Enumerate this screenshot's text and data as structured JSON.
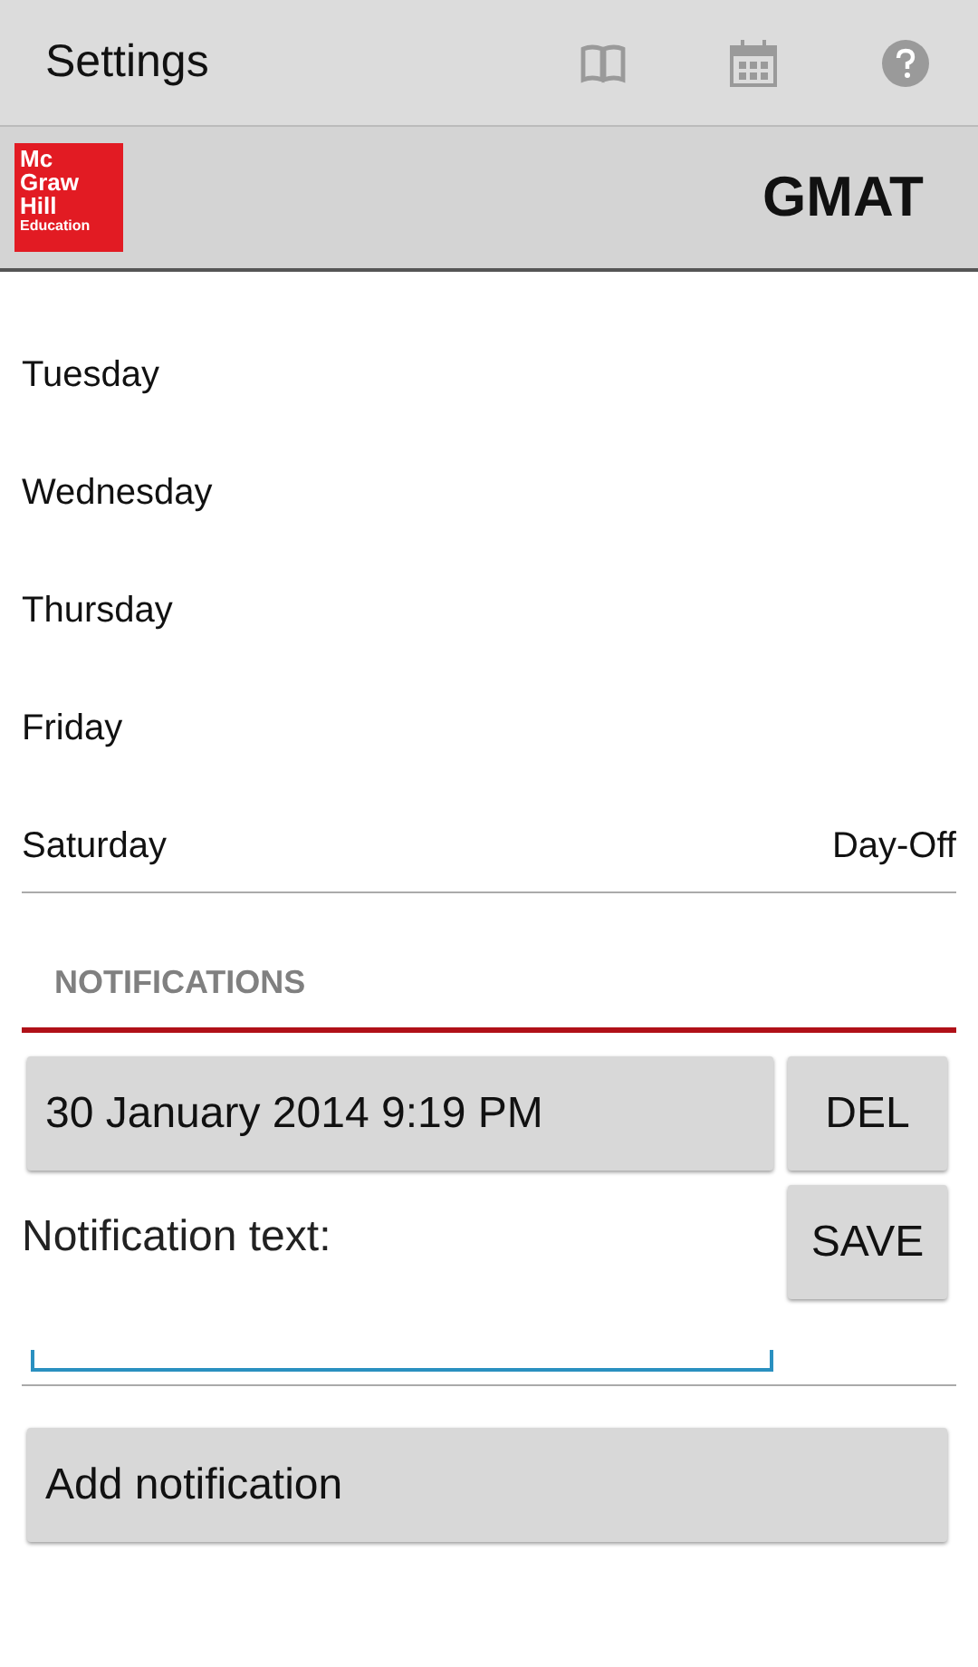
{
  "action_bar": {
    "title": "Settings",
    "actions": [
      {
        "kind": "book"
      },
      {
        "kind": "calendar"
      },
      {
        "kind": "help"
      }
    ]
  },
  "header": {
    "logo_lines": [
      "Mc",
      "Graw",
      "Hill",
      "Education"
    ],
    "title": "GMAT"
  },
  "days": [
    {
      "name": "Tuesday"
    },
    {
      "name": "Wednesday"
    },
    {
      "name": "Thursday"
    },
    {
      "name": "Friday"
    },
    {
      "name": "Saturday",
      "value": "Day-Off"
    }
  ],
  "notifications": {
    "heading": "NOTIFICATIONS",
    "date": "30 January 2014 9:19 PM",
    "delete_label": "DEL",
    "text_label": "Notification text:",
    "save_label": "SAVE",
    "add_label": "Add notification"
  }
}
